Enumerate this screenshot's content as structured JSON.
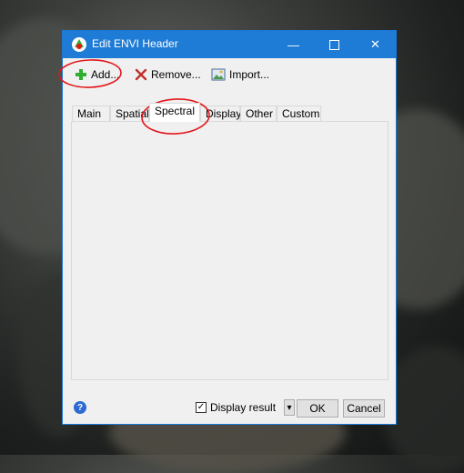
{
  "window": {
    "title": "Edit ENVI Header",
    "icon": "envi-app-icon",
    "controls": {
      "minimize": "—",
      "maximize": "",
      "close": "✕"
    }
  },
  "toolbar": {
    "add_label": "Add...",
    "remove_label": "Remove...",
    "import_label": "Import...",
    "add_icon": "plus-icon",
    "remove_icon": "x-icon",
    "import_icon": "image-import-icon"
  },
  "tabs": [
    {
      "label": "Main",
      "active": false
    },
    {
      "label": "Spatial",
      "active": false
    },
    {
      "label": "Spectral",
      "active": true
    },
    {
      "label": "Display",
      "active": false
    },
    {
      "label": "Other",
      "active": false
    },
    {
      "label": "Custom",
      "active": false
    }
  ],
  "footer": {
    "help_icon": "help-icon",
    "help_glyph": "?",
    "display_result_label": "Display result",
    "display_result_checked": true,
    "check_glyph": "✓",
    "dropdown_glyph": "▾",
    "ok_label": "OK",
    "cancel_label": "Cancel"
  },
  "colors": {
    "titlebar": "#1f7cd6",
    "annotation": "#e3161a",
    "add_icon": "#2fae2f",
    "remove_icon": "#c0302a"
  }
}
